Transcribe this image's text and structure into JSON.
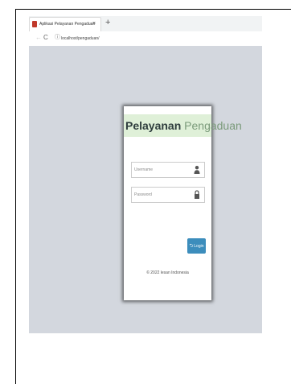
{
  "browser": {
    "tab_title": "Aplikasi Pelayanan Pengaduan",
    "tab_close": "×",
    "new_tab": "+",
    "url": "localhost/pengaduan/",
    "back_glyph": "←",
    "reload_glyph": "C",
    "info_glyph": "ⓘ"
  },
  "login": {
    "title_strong": "Pelayanan",
    "title_light": " Pengaduan",
    "username_placeholder": "Username",
    "password_placeholder": "Password",
    "username_icon": "user-icon",
    "password_icon": "lock-icon",
    "button_label": "Login",
    "button_icon": "sign-in-icon",
    "button_glyph": "⮌",
    "footer": "© 2022 lesan Indonesia"
  },
  "colors": {
    "viewport_bg": "#d3d7de",
    "header_bg": "#dff0d8",
    "button_bg": "#3c8dbc"
  }
}
